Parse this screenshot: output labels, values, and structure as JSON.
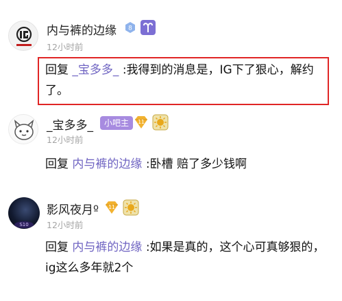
{
  "comments": [
    {
      "user": "内与裤的边缘",
      "level": "8",
      "time": "12小时前",
      "reply_prefix": "回复",
      "mention": "_宝多多_",
      "text_line1": ":我得到的消息是，IG下了狠心，解约",
      "text_line2": "了。"
    },
    {
      "user": "_宝多多_",
      "tag": "小吧主",
      "level": "11",
      "time": "12小时前",
      "reply_prefix": "回复",
      "mention": "内与裤的边缘",
      "text_line1": ":卧槽 赔了多少钱啊"
    },
    {
      "user": "影风夜月º",
      "level": "11",
      "time": "12小时前",
      "reply_prefix": "回复",
      "mention": "内与裤的边缘",
      "text_line1": ":如果是真的，这个心可真够狠的，",
      "text_line2": "ig这么多年就2个"
    }
  ],
  "colors": {
    "highlight": "#e02525",
    "mention": "#6f64c2",
    "tag_bg": "#a78be0",
    "gold": "#f2b230"
  },
  "icons": [
    "ig-logo-avatar",
    "aries-icon",
    "level-badge-icon",
    "gold-badge-icon",
    "sun-medal-icon",
    "cartoon-avatar",
    "dark-avatar"
  ]
}
